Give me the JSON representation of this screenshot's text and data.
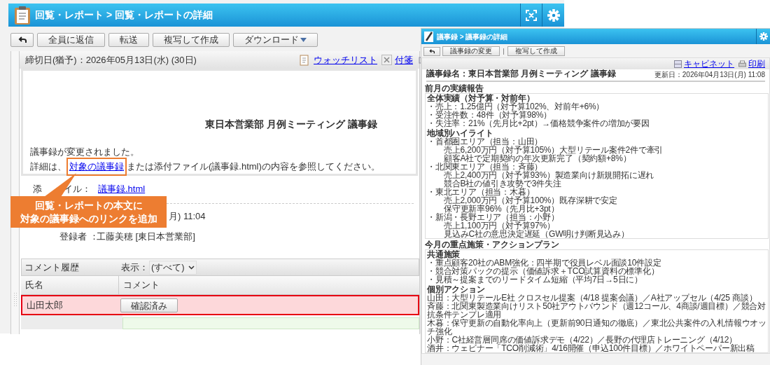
{
  "main_window": {
    "breadcrumb": "回覧・レポート > 回覧・レポートの詳細",
    "toolbar": [
      "全員に返信",
      "転送",
      "複写して作成",
      "ダウンロード"
    ],
    "deadline": "締切日(猶予)：2026年05月13日(水) (30日)",
    "links": [
      "ウォッチリスト",
      "付箋"
    ],
    "body": {
      "title": "東日本営業部 月例ミーティング 議事録",
      "line": "議事録が変更されました。",
      "detail_prefix": "詳細は、",
      "link": "対象の議事録",
      "detail_suffix": "または添付ファイル(議事録.html)の内容を参照してください。"
    },
    "attachment": {
      "label_parts": [
        "添",
        "イル："
      ],
      "file": "議事録.html"
    },
    "date_visible": "月) 11:04",
    "registrant": {
      "label": "登録者 ：",
      "value": "工藤美穂 [東日本営業部]"
    },
    "comments": {
      "title": "コメント履歴",
      "filter_label": "表示：",
      "filter_value": "(すべて)",
      "columns": [
        "氏名",
        "コメント"
      ],
      "rows": [
        {
          "name": "山田太郎",
          "button": "確認済み",
          "highlighted": true
        }
      ]
    }
  },
  "callout": {
    "lines": [
      "回覧・レポートの本文に",
      "対象の議事録へのリンクを追加"
    ]
  },
  "minutes_window": {
    "breadcrumb": "議事録 > 議事録の詳細",
    "toolbar": [
      "議事録の変更",
      "複写して作成"
    ],
    "links": [
      "キャビネット",
      "印刷"
    ],
    "title": "議事録名：東日本営業部 月例ミーティング 議事録",
    "updated": "更新日：2026年04月13日(月) 11:08",
    "sections": [
      {
        "heading": "前月の実績報告",
        "blocks": [
          {
            "title": "全体実績（対予算・対前年）",
            "lines": [
              {
                "text": "・売上：1.25億円（対予算102%、対前年+6%）"
              },
              {
                "text": "・受注件数：48件（対予算98%）"
              },
              {
                "text": "・失注率：21%（先月比+2pt）→価格競争案件の増加が要因"
              }
            ]
          },
          {
            "title": "地域別ハイライト",
            "lines": [
              {
                "text": "・首都圏エリア（担当：山田）",
                "children": [
                  {
                    "text": "売上6,200万円（対予算105%）大型リテール案件2件で牽引"
                  },
                  {
                    "text": "顧客A社で定期契約の年次更新完了（契約額+8%）"
                  }
                ]
              },
              {
                "text": "・北関東エリア（担当：斉藤）",
                "children": [
                  {
                    "text": "売上2,400万円（対予算93%）製造業向け新規開拓に遅れ"
                  },
                  {
                    "text": "競合B社の値引き攻勢で3件失注"
                  }
                ]
              },
              {
                "text": "・東北エリア（担当：木暮）",
                "children": [
                  {
                    "text": "売上2,000万円（対予算100%）既存深耕で安定"
                  },
                  {
                    "text": "保守更新率96%（先月比+3pt）"
                  }
                ]
              },
              {
                "text": "・新潟・長野エリア（担当：小野）",
                "children": [
                  {
                    "text": "売上1,100万円（対予算97%）"
                  },
                  {
                    "text": "見込みC社の意思決定遅延（GW明け判断見込み）"
                  }
                ]
              }
            ]
          }
        ]
      },
      {
        "heading": "今月の重点施策・アクションプラン",
        "blocks": [
          {
            "title": "共通施策",
            "lines": [
              {
                "text": "・重点顧客20社のABM強化：四半期で役員レベル面談10件設定"
              },
              {
                "text": "・競合対策パックの提示（価値訴求＋TCO試算資料の標準化）"
              },
              {
                "text": "・見積～提案までのリードタイム短縮（平均7日→5日に）"
              }
            ]
          },
          {
            "title": "個別アクション",
            "lines": [
              {
                "text": "山田：大型リテールE社 クロスセル提案（4/18 提案会議）／A社アップセル（4/25 商談）"
              },
              {
                "text": "斉藤：北関東製造業向けリスト50社アウトバウンド（週12コール、4商談/週目標）／競合対抗条件テンプレ適用"
              },
              {
                "text": "木暮：保守更新の自動化率向上（更新前90日通知の徹底）／東北公共案件の入札情報ウオッチ強化"
              },
              {
                "text": "小野：C社経営層同席の価値訴求デモ（4/22）／長野の代理店トレーニング（4/12）"
              },
              {
                "text": "酒井：ウェビナー「TCO削減術」4/16開催（申込100件目標）／ホワイトペーパー新出稿"
              }
            ]
          }
        ]
      }
    ]
  }
}
